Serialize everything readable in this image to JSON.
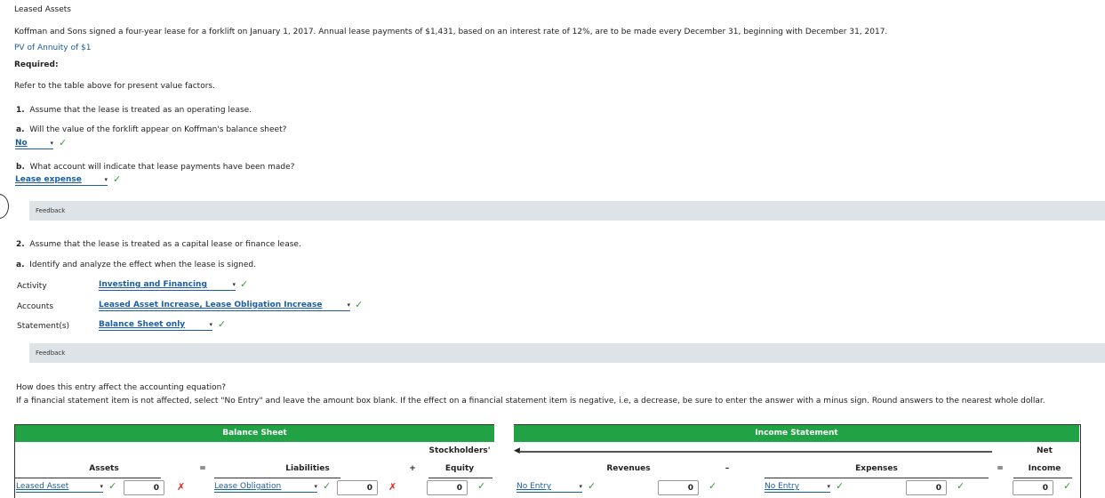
{
  "title": "Leased Assets",
  "intro": "Koffman and Sons signed a four-year lease for a forklift on January 1, 2017. Annual lease payments of $1,431, based on an interest rate of 12%, are to be made every December 31, beginning with December 31, 2017.",
  "pv_link": "PV of Annuity of $1",
  "required": "Required:",
  "refer": "Refer to the table above for present value factors.",
  "q1": {
    "num": "1.",
    "text": "Assume that the lease is treated as an operating lease.",
    "a": {
      "num": "a.",
      "text": "Will the value of the forklift appear on Koffman's balance sheet?",
      "answer": "No"
    },
    "b": {
      "num": "b.",
      "text": "What account will indicate that lease payments have been made?",
      "answer": "Lease expense"
    },
    "feedback": "Feedback"
  },
  "q2": {
    "num": "2.",
    "text": "Assume that the lease is treated as a capital lease or finance lease.",
    "a": {
      "num": "a.",
      "text": "Identify and analyze the effect when the lease is signed."
    },
    "rows": [
      {
        "label": "Activity",
        "answer": "Investing and Financing"
      },
      {
        "label": "Accounts",
        "answer": "Leased Asset Increase, Lease Obligation Increase"
      },
      {
        "label": "Statement(s)",
        "answer": "Balance Sheet only"
      }
    ],
    "feedback": "Feedback",
    "eq_q": "How does this entry affect the accounting equation?",
    "eq_inst": "If a financial statement item is not affected, select \"No Entry\" and leave the amount box blank. If the effect on a financial statement item is negative, i.e, a decrease, be sure to enter the answer with a minus sign. Round answers to the nearest whole dollar."
  },
  "table": {
    "balance_sheet": "Balance Sheet",
    "income_statement": "Income Statement",
    "assets": "Assets",
    "eq1": "=",
    "liabilities": "Liabilities",
    "plus": "+",
    "se1": "Stockholders'",
    "se2": "Equity",
    "revenues": "Revenues",
    "minus": "–",
    "expenses": "Expenses",
    "eq2": "=",
    "ni1": "Net",
    "ni2": "Income",
    "asset_account": "Leased Asset",
    "asset_amount": "0",
    "liab_account": "Lease Obligation",
    "liab_amount": "0",
    "equity_amount": "0",
    "rev_account": "No Entry",
    "rev_amount": "0",
    "exp_account": "No Entry",
    "exp_amount": "0",
    "ni_amount": "0"
  },
  "colors": {
    "header_green": "#21a345",
    "correct": "#3a9a3a",
    "incorrect": "#e02020"
  }
}
